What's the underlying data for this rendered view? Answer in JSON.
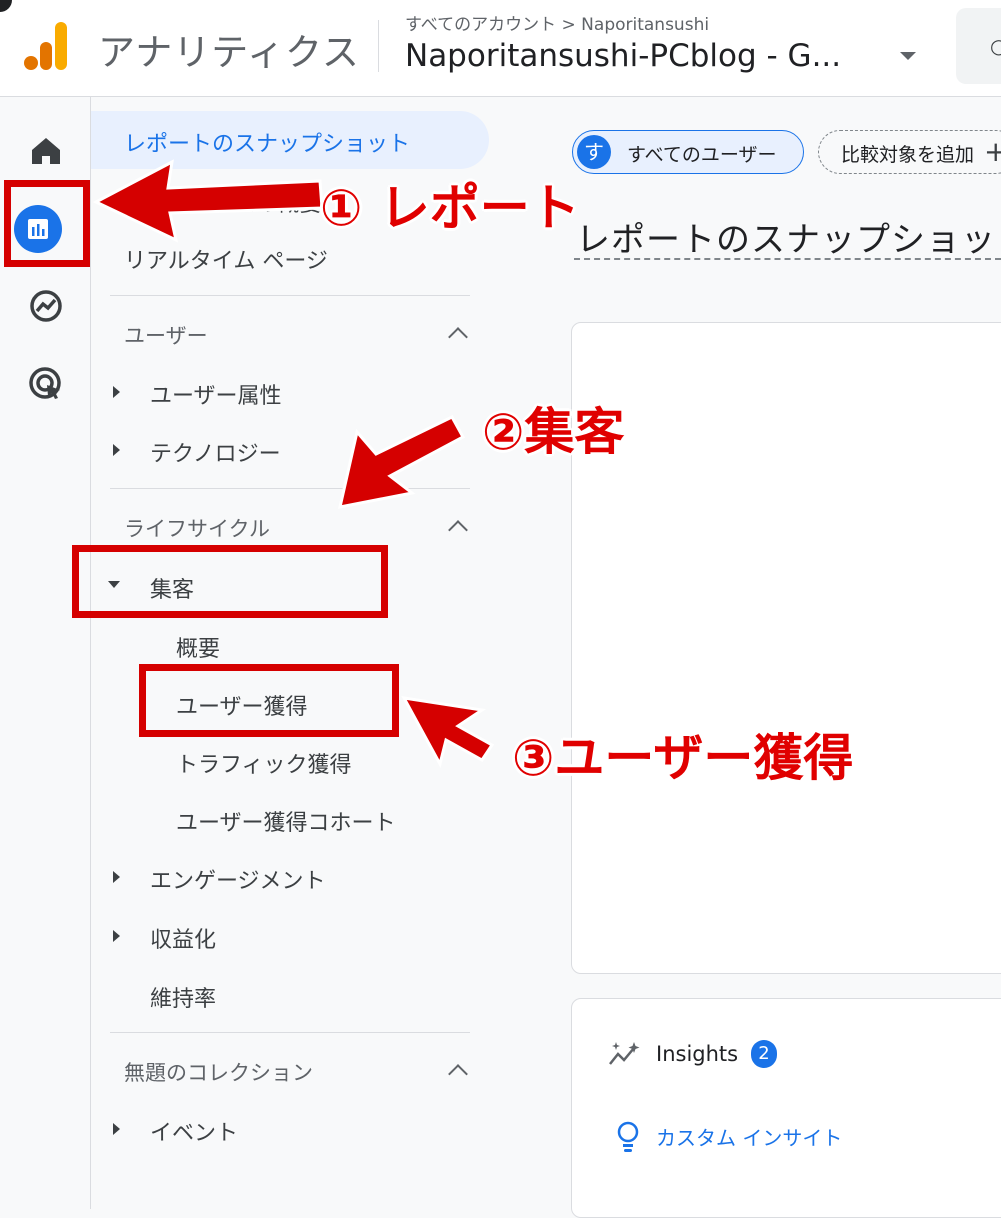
{
  "header": {
    "app_title": "アナリティクス",
    "breadcrumb": "すべてのアカウント > Naporitansushi",
    "property_name": "Naporitansushi-PCblog - G..."
  },
  "nav": {
    "reports_snapshot": "レポートのスナップショット",
    "realtime_overview": "リアルタイムの概要",
    "realtime_page": "リアルタイム ページ",
    "section_user": "ユーザー",
    "user_attributes": "ユーザー属性",
    "technology": "テクノロジー",
    "section_lifecycle": "ライフサイクル",
    "acquisition": "集客",
    "overview": "概要",
    "user_acquisition": "ユーザー獲得",
    "traffic_acquisition": "トラフィック獲得",
    "user_acquisition_cohort": "ユーザー獲得コホート",
    "engagement": "エンゲージメント",
    "monetization": "収益化",
    "retention": "維持率",
    "section_collection": "無題のコレクション",
    "events": "イベント"
  },
  "main": {
    "chip_avatar": "す",
    "chip_all_users": "すべてのユーザー",
    "chip_add_comparison": "比較対象を追加",
    "chip_add_icon": "+",
    "page_title": "レポートのスナップショット",
    "insights_label": "Insights",
    "insights_count": "2",
    "custom_insight": "カスタム インサイト"
  },
  "annotations": {
    "step1": "① レポート",
    "step2": "②集客",
    "step3": "③ユーザー獲得"
  },
  "colors": {
    "accent": "#1a73e8",
    "annotation_red": "#d50000"
  }
}
